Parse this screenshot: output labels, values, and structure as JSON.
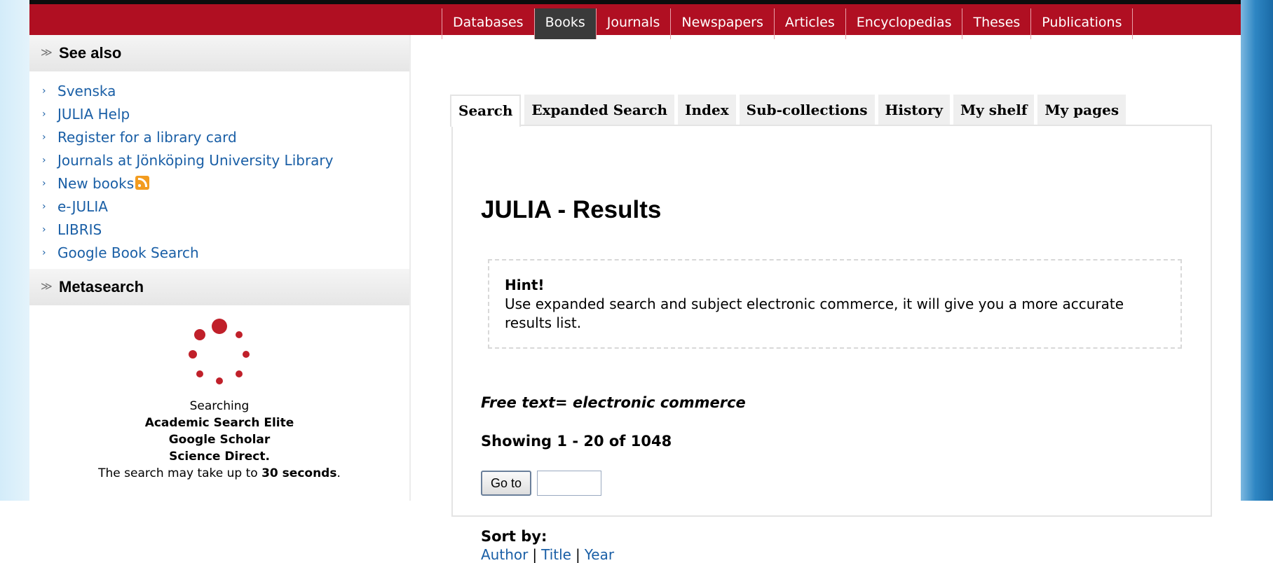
{
  "topnav": {
    "items": [
      "Databases",
      "Books",
      "Journals",
      "Newspapers",
      "Articles",
      "Encyclopedias",
      "Theses",
      "Publications"
    ],
    "active_index": 1
  },
  "sidebar": {
    "see_also": {
      "header": "See also",
      "links": [
        "Svenska",
        "JULIA Help",
        "Register for a library card",
        "Journals at Jönköping University Library",
        "New books",
        "e-JULIA",
        "LIBRIS",
        "Google Book Search"
      ]
    },
    "metasearch": {
      "header": "Metasearch",
      "searching_label": "Searching",
      "sources": [
        "Academic Search Elite",
        "Google Scholar",
        "Science Direct."
      ],
      "note_prefix": "The search may take up to",
      "note_time": "30 seconds",
      "note_suffix": "."
    }
  },
  "main": {
    "tabs": [
      "Search",
      "Expanded Search",
      "Index",
      "Sub-collections",
      "History",
      "My shelf",
      "My pages"
    ],
    "active_tab_index": 0,
    "title": "JULIA - Results",
    "hint": {
      "title": "Hint!",
      "text": "Use expanded search and subject electronic commerce, it will give you a more accurate results list."
    },
    "free_text": "Free text= electronic commerce",
    "showing": "Showing 1 - 20 of 1048",
    "goto_button": "Go to",
    "goto_value": "",
    "sort_label": "Sort by:",
    "sort_options": [
      "Author",
      "Title",
      "Year"
    ],
    "sort_separator": "|"
  },
  "colors": {
    "topbar": "#b00f22",
    "active_nav": "#3a3a3a",
    "link": "#1a5fa6",
    "rss": "#f39c1f",
    "spinner": "#c0202a"
  },
  "icons": {
    "section_toggle": "double-chevron-down-icon",
    "link_bullet": "chevron-right-icon",
    "rss": "rss-feed-icon",
    "loading": "loading-spinner-icon"
  }
}
